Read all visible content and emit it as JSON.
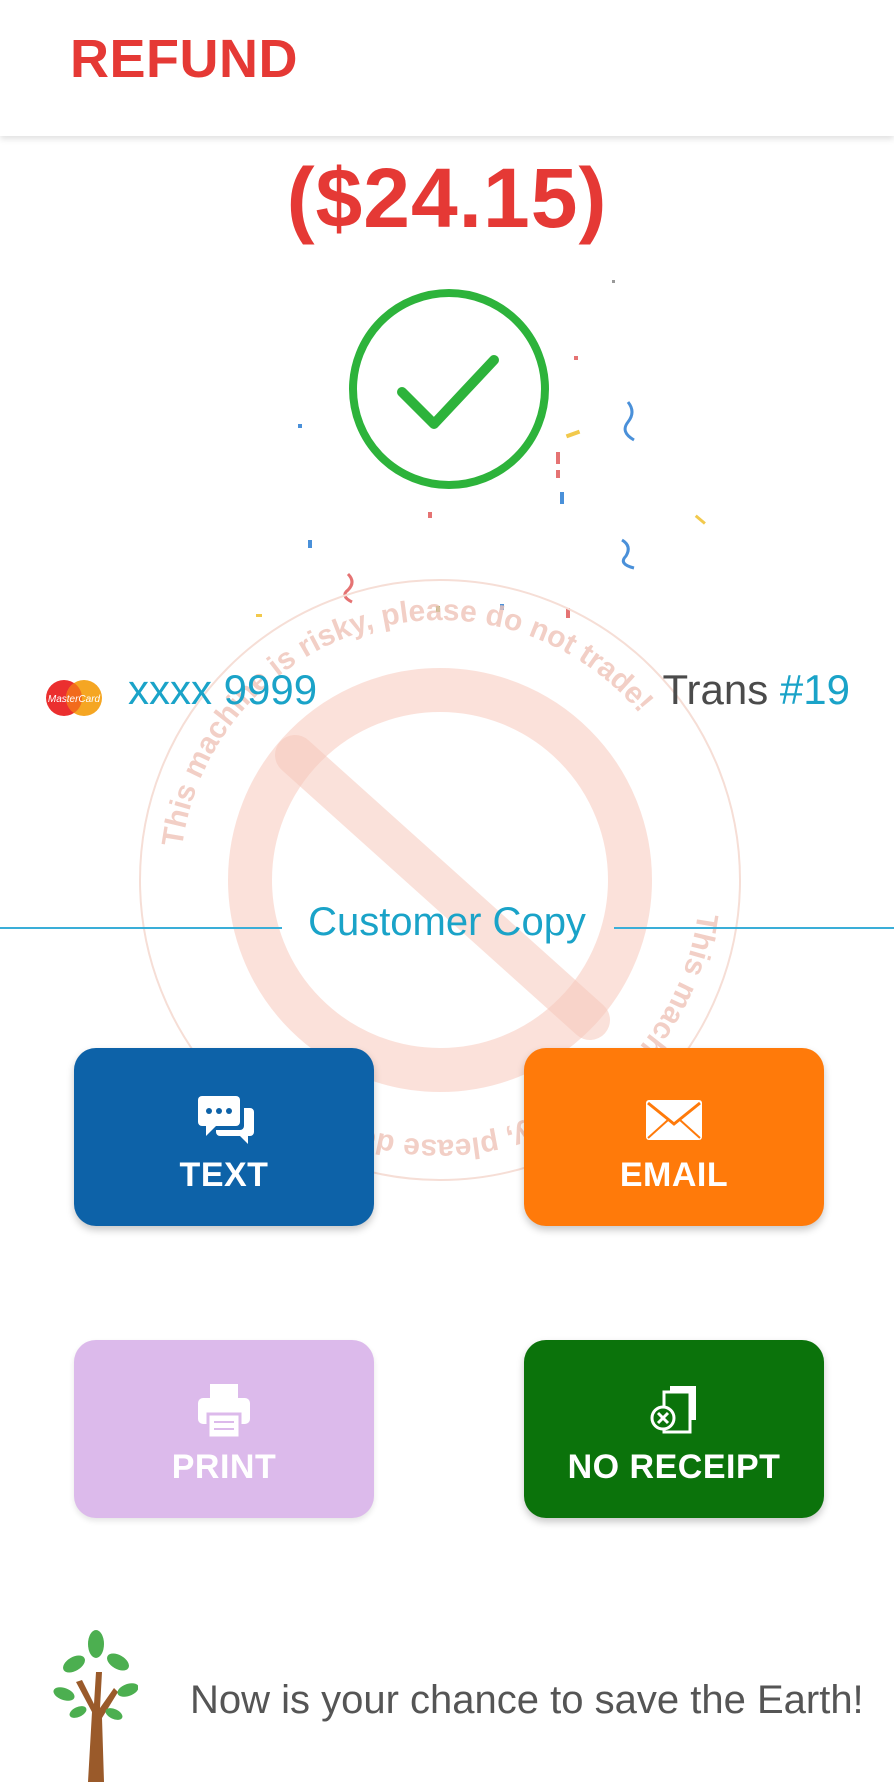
{
  "header": {
    "title": "REFUND"
  },
  "amount": "($24.15)",
  "status": {
    "icon": "checkmark-circle-icon",
    "color": "#2db33b"
  },
  "card": {
    "brand": "MasterCard",
    "number": "xxxx 9999"
  },
  "transaction": {
    "label": "Trans",
    "number": "#19"
  },
  "watermark": {
    "top_text": "This machine is risky, please do not trade!",
    "bottom_text": "This machine is risky, please do not trade!"
  },
  "receipt": {
    "section_label": "Customer Copy",
    "buttons": [
      {
        "label": "TEXT",
        "icon": "chat-bubbles-icon",
        "color": "#0d62a8"
      },
      {
        "label": "EMAIL",
        "icon": "envelope-icon",
        "color": "#ff7a0a"
      },
      {
        "label": "PRINT",
        "icon": "printer-icon",
        "color": "#dcbaeb"
      },
      {
        "label": "NO RECEIPT",
        "icon": "no-receipt-icon",
        "color": "#0b730b"
      }
    ]
  },
  "footer": {
    "message": "Now is your chance to save the Earth!",
    "icon": "tree-icon"
  },
  "colors": {
    "accent_red": "#e53935",
    "accent_blue": "#1aa3c8"
  }
}
